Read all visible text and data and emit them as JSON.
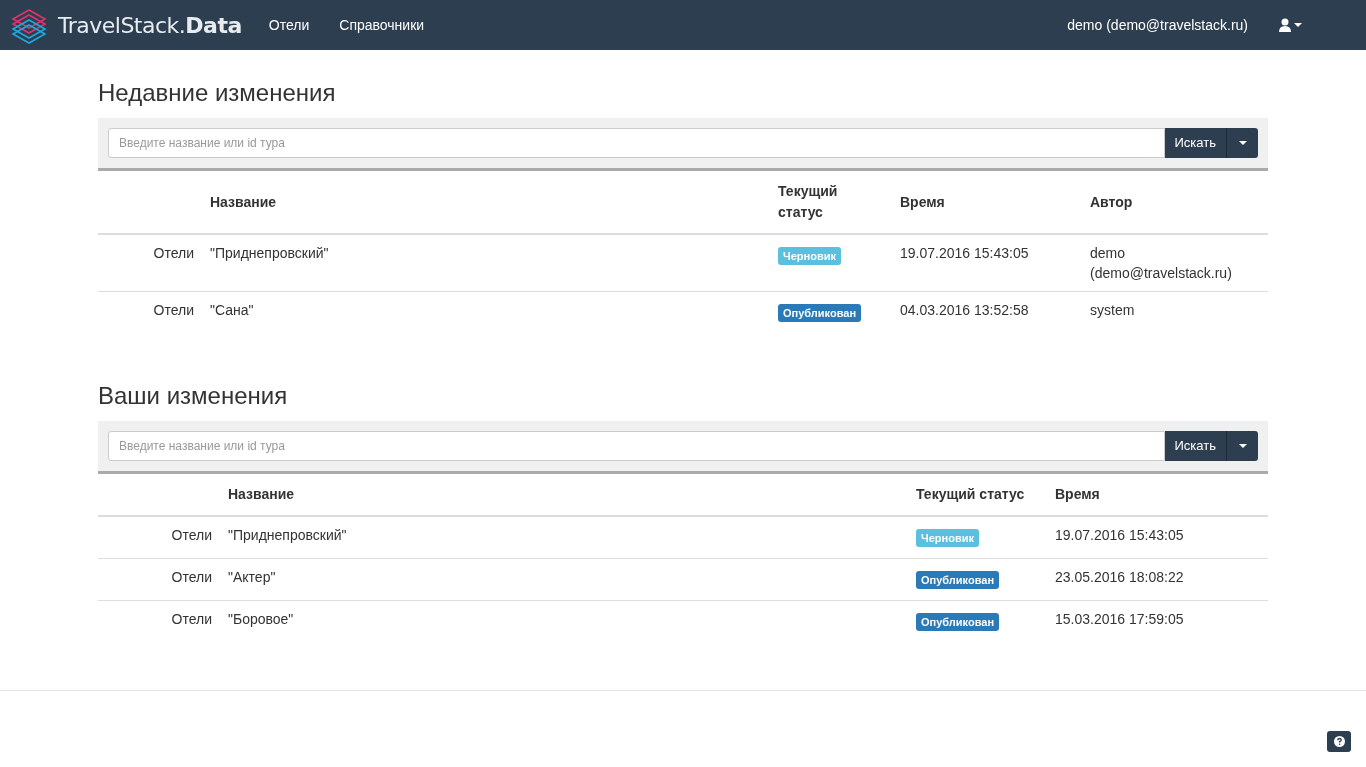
{
  "navbar": {
    "brand": "TravelStack.**Data**",
    "menu": [
      {
        "label": "Отели"
      },
      {
        "label": "Справочники"
      }
    ],
    "user": "demo (demo@travelstack.ru)"
  },
  "sections": [
    {
      "title": "Недавние изменения",
      "search": {
        "placeholder": "Введите название или id тура",
        "button": "Искать"
      },
      "columns": [
        "Название",
        "Текущий статус",
        "Время",
        "Автор"
      ],
      "rows": [
        {
          "category": "Отели",
          "name": "\"Приднепровский\"",
          "status": {
            "label": "Черновик",
            "kind": "draft"
          },
          "time": "19.07.2016 15:43:05",
          "author": "demo (demo@travelstack.ru)"
        },
        {
          "category": "Отели",
          "name": "\"Сана\"",
          "status": {
            "label": "Опубликован",
            "kind": "published"
          },
          "time": "04.03.2016 13:52:58",
          "author": "system"
        }
      ]
    },
    {
      "title": "Ваши изменения",
      "search": {
        "placeholder": "Введите название или id тура",
        "button": "Искать"
      },
      "columns": [
        "Название",
        "Текущий статус",
        "Время"
      ],
      "rows": [
        {
          "category": "Отели",
          "name": "\"Приднепровский\"",
          "status": {
            "label": "Черновик",
            "kind": "draft"
          },
          "time": "19.07.2016 15:43:05"
        },
        {
          "category": "Отели",
          "name": "\"Актер\"",
          "status": {
            "label": "Опубликован",
            "kind": "published"
          },
          "time": "23.05.2016 18:08:22"
        },
        {
          "category": "Отели",
          "name": "\"Боровое\"",
          "status": {
            "label": "Опубликован",
            "kind": "published"
          },
          "time": "15.03.2016 17:59:05"
        }
      ]
    }
  ]
}
